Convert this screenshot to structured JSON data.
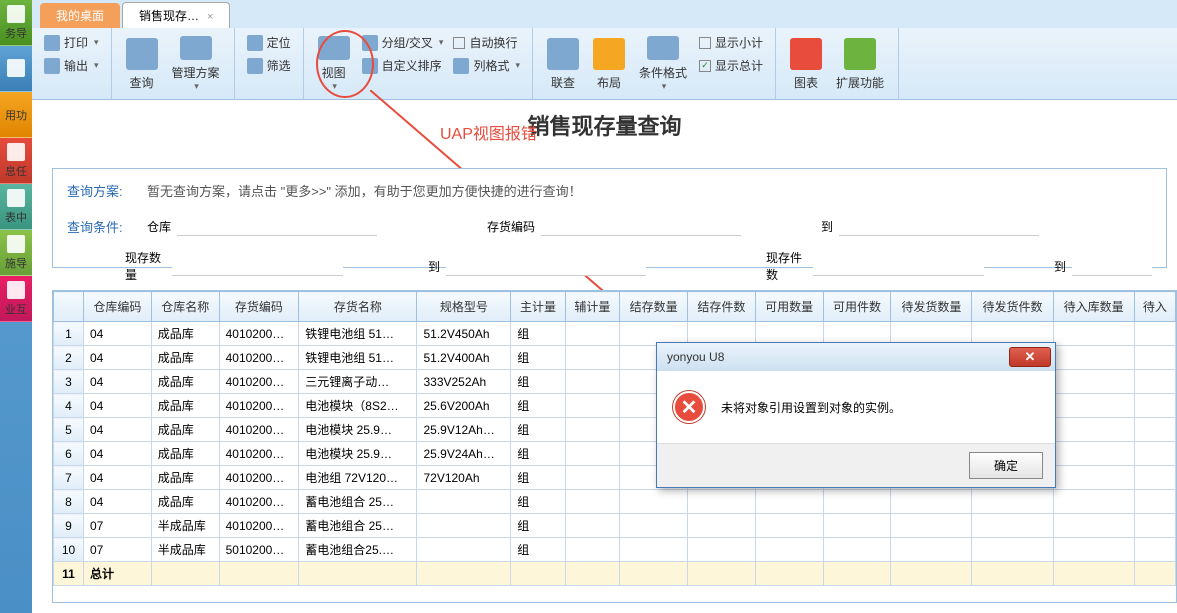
{
  "sidebar": {
    "items": [
      {
        "label": "务导"
      },
      {
        "label": "用功"
      },
      {
        "label": "息任"
      },
      {
        "label": "表中"
      },
      {
        "label": "施导"
      },
      {
        "label": "业互"
      }
    ]
  },
  "tabs": {
    "items": [
      {
        "label": "我的桌面"
      },
      {
        "label": "销售现存…"
      }
    ]
  },
  "ribbon": {
    "print": "打印",
    "export": "输出",
    "query": "查询",
    "plan": "管理方案",
    "locate": "定位",
    "filter": "筛选",
    "view": "视图",
    "group": "分组/交叉",
    "sort": "自定义排序",
    "autowrap": "自动换行",
    "colfmt": "列格式",
    "link": "联查",
    "layout": "布局",
    "condfmt": "条件格式",
    "subtotal": "显示小计",
    "grandtotal": "显示总计",
    "chart": "图表",
    "extend": "扩展功能"
  },
  "page_title": "销售现存量查询",
  "annotation": "UAP视图报错",
  "query": {
    "plan_label": "查询方案:",
    "plan_text": "暂无查询方案，请点击 \"更多>>\" 添加，有助于您更加方便快捷的进行查询！",
    "cond_label": "查询条件:",
    "fields": {
      "warehouse": "仓库",
      "invcode": "存货编码",
      "to1": "到",
      "qty": "现存数量",
      "to2": "到",
      "pieces": "现存件数",
      "to3": "到"
    }
  },
  "table": {
    "headers": [
      "",
      "仓库编码",
      "仓库名称",
      "存货编码",
      "存货名称",
      "规格型号",
      "主计量",
      "辅计量",
      "结存数量",
      "结存件数",
      "可用数量",
      "可用件数",
      "待发货数量",
      "待发货件数",
      "待入库数量",
      "待入"
    ],
    "rows": [
      {
        "n": "1",
        "wc": "04",
        "wn": "成品库",
        "ic": "4010200…",
        "in": "铁锂电池组 51…",
        "spec": "51.2V450Ah",
        "um": "组"
      },
      {
        "n": "2",
        "wc": "04",
        "wn": "成品库",
        "ic": "4010200…",
        "in": "铁锂电池组 51…",
        "spec": "51.2V400Ah",
        "um": "组"
      },
      {
        "n": "3",
        "wc": "04",
        "wn": "成品库",
        "ic": "4010200…",
        "in": "三元锂离子动…",
        "spec": "333V252Ah",
        "um": "组"
      },
      {
        "n": "4",
        "wc": "04",
        "wn": "成品库",
        "ic": "4010200…",
        "in": "电池模块（8S2…",
        "spec": "25.6V200Ah",
        "um": "组"
      },
      {
        "n": "5",
        "wc": "04",
        "wn": "成品库",
        "ic": "4010200…",
        "in": "电池模块 25.9…",
        "spec": "25.9V12Ah…",
        "um": "组"
      },
      {
        "n": "6",
        "wc": "04",
        "wn": "成品库",
        "ic": "4010200…",
        "in": "电池模块 25.9…",
        "spec": "25.9V24Ah…",
        "um": "组"
      },
      {
        "n": "7",
        "wc": "04",
        "wn": "成品库",
        "ic": "4010200…",
        "in": "电池组 72V120…",
        "spec": "72V120Ah",
        "um": "组"
      },
      {
        "n": "8",
        "wc": "04",
        "wn": "成品库",
        "ic": "4010200…",
        "in": "蓄电池组合  25…",
        "spec": "",
        "um": "组"
      },
      {
        "n": "9",
        "wc": "07",
        "wn": "半成品库",
        "ic": "4010200…",
        "in": "蓄电池组合  25…",
        "spec": "",
        "um": "组"
      },
      {
        "n": "10",
        "wc": "07",
        "wn": "半成品库",
        "ic": "5010200…",
        "in": "蓄电池组合25.…",
        "spec": "",
        "um": "组"
      }
    ],
    "total_label": "总计"
  },
  "dialog": {
    "title": "yonyou U8",
    "message": "未将对象引用设置到对象的实例。",
    "ok": "确定"
  }
}
